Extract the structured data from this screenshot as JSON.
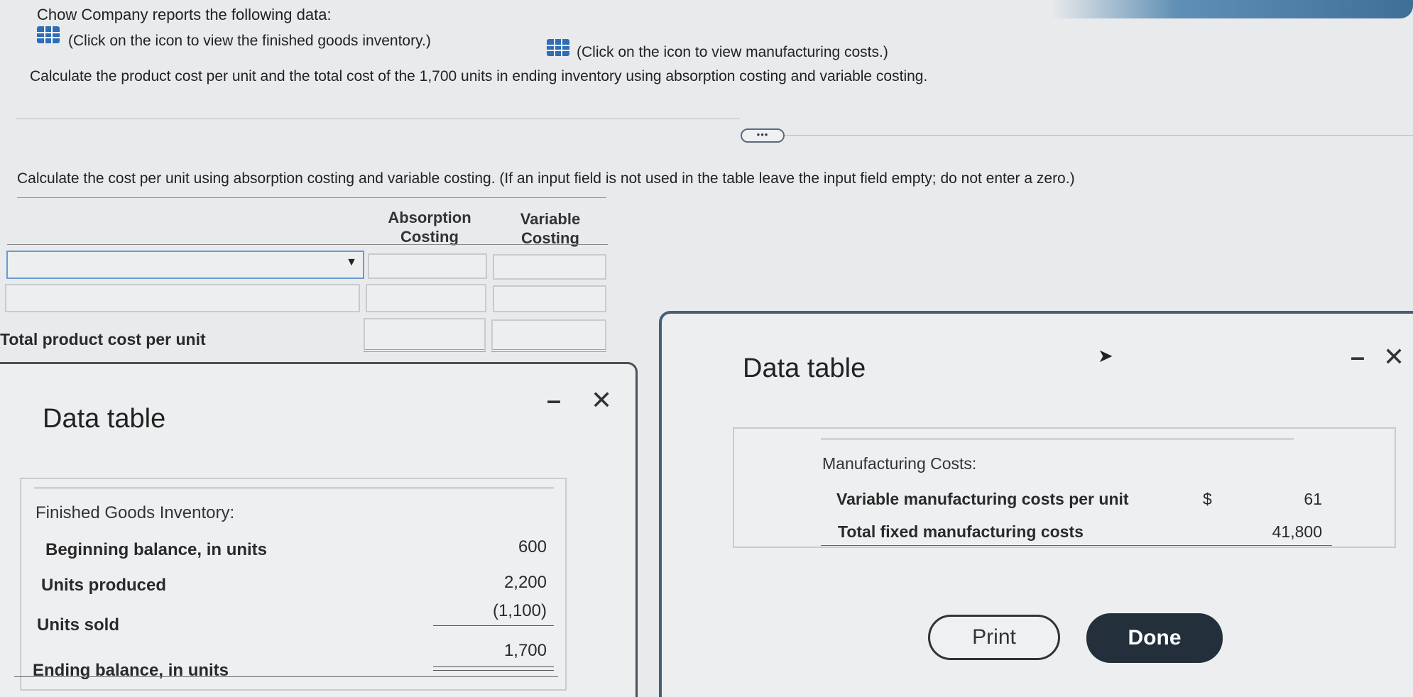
{
  "intro": {
    "title": "Chow Company reports the following data:",
    "link_inventory": "(Click on the icon to view the finished goods inventory.)",
    "link_costs": "(Click on the icon to view manufacturing costs.)",
    "instruction": "Calculate the product cost per unit and the total cost of the 1,700 units in ending inventory using absorption costing and variable costing."
  },
  "expand_button": "•••",
  "question": {
    "prompt": "Calculate the cost per unit using absorption costing and variable costing. (If an input field is not used in the table leave the input field empty; do not enter a zero.)",
    "col_absorption": [
      "Absorption",
      "Costing"
    ],
    "col_variable": [
      "Variable",
      "Costing"
    ],
    "total_label": "Total product cost per unit"
  },
  "data_table_left": {
    "title": "Data table",
    "section_heading": "Finished Goods Inventory:",
    "rows": [
      {
        "label": "Beginning balance, in units",
        "value": "600"
      },
      {
        "label": "Units produced",
        "value": "2,200"
      },
      {
        "label": "Units sold",
        "value": "(1,100)"
      },
      {
        "label": "Ending balance, in units",
        "value": "1,700"
      }
    ]
  },
  "data_table_right": {
    "title": "Data table",
    "section_heading": "Manufacturing Costs:",
    "rows": [
      {
        "label": "Variable manufacturing costs per unit",
        "currency": "$",
        "value": "61"
      },
      {
        "label": "Total fixed manufacturing costs",
        "currency": "",
        "value": "41,800"
      }
    ],
    "print_label": "Print",
    "done_label": "Done"
  },
  "window_controls": {
    "minimize": "–",
    "close": "✕"
  }
}
